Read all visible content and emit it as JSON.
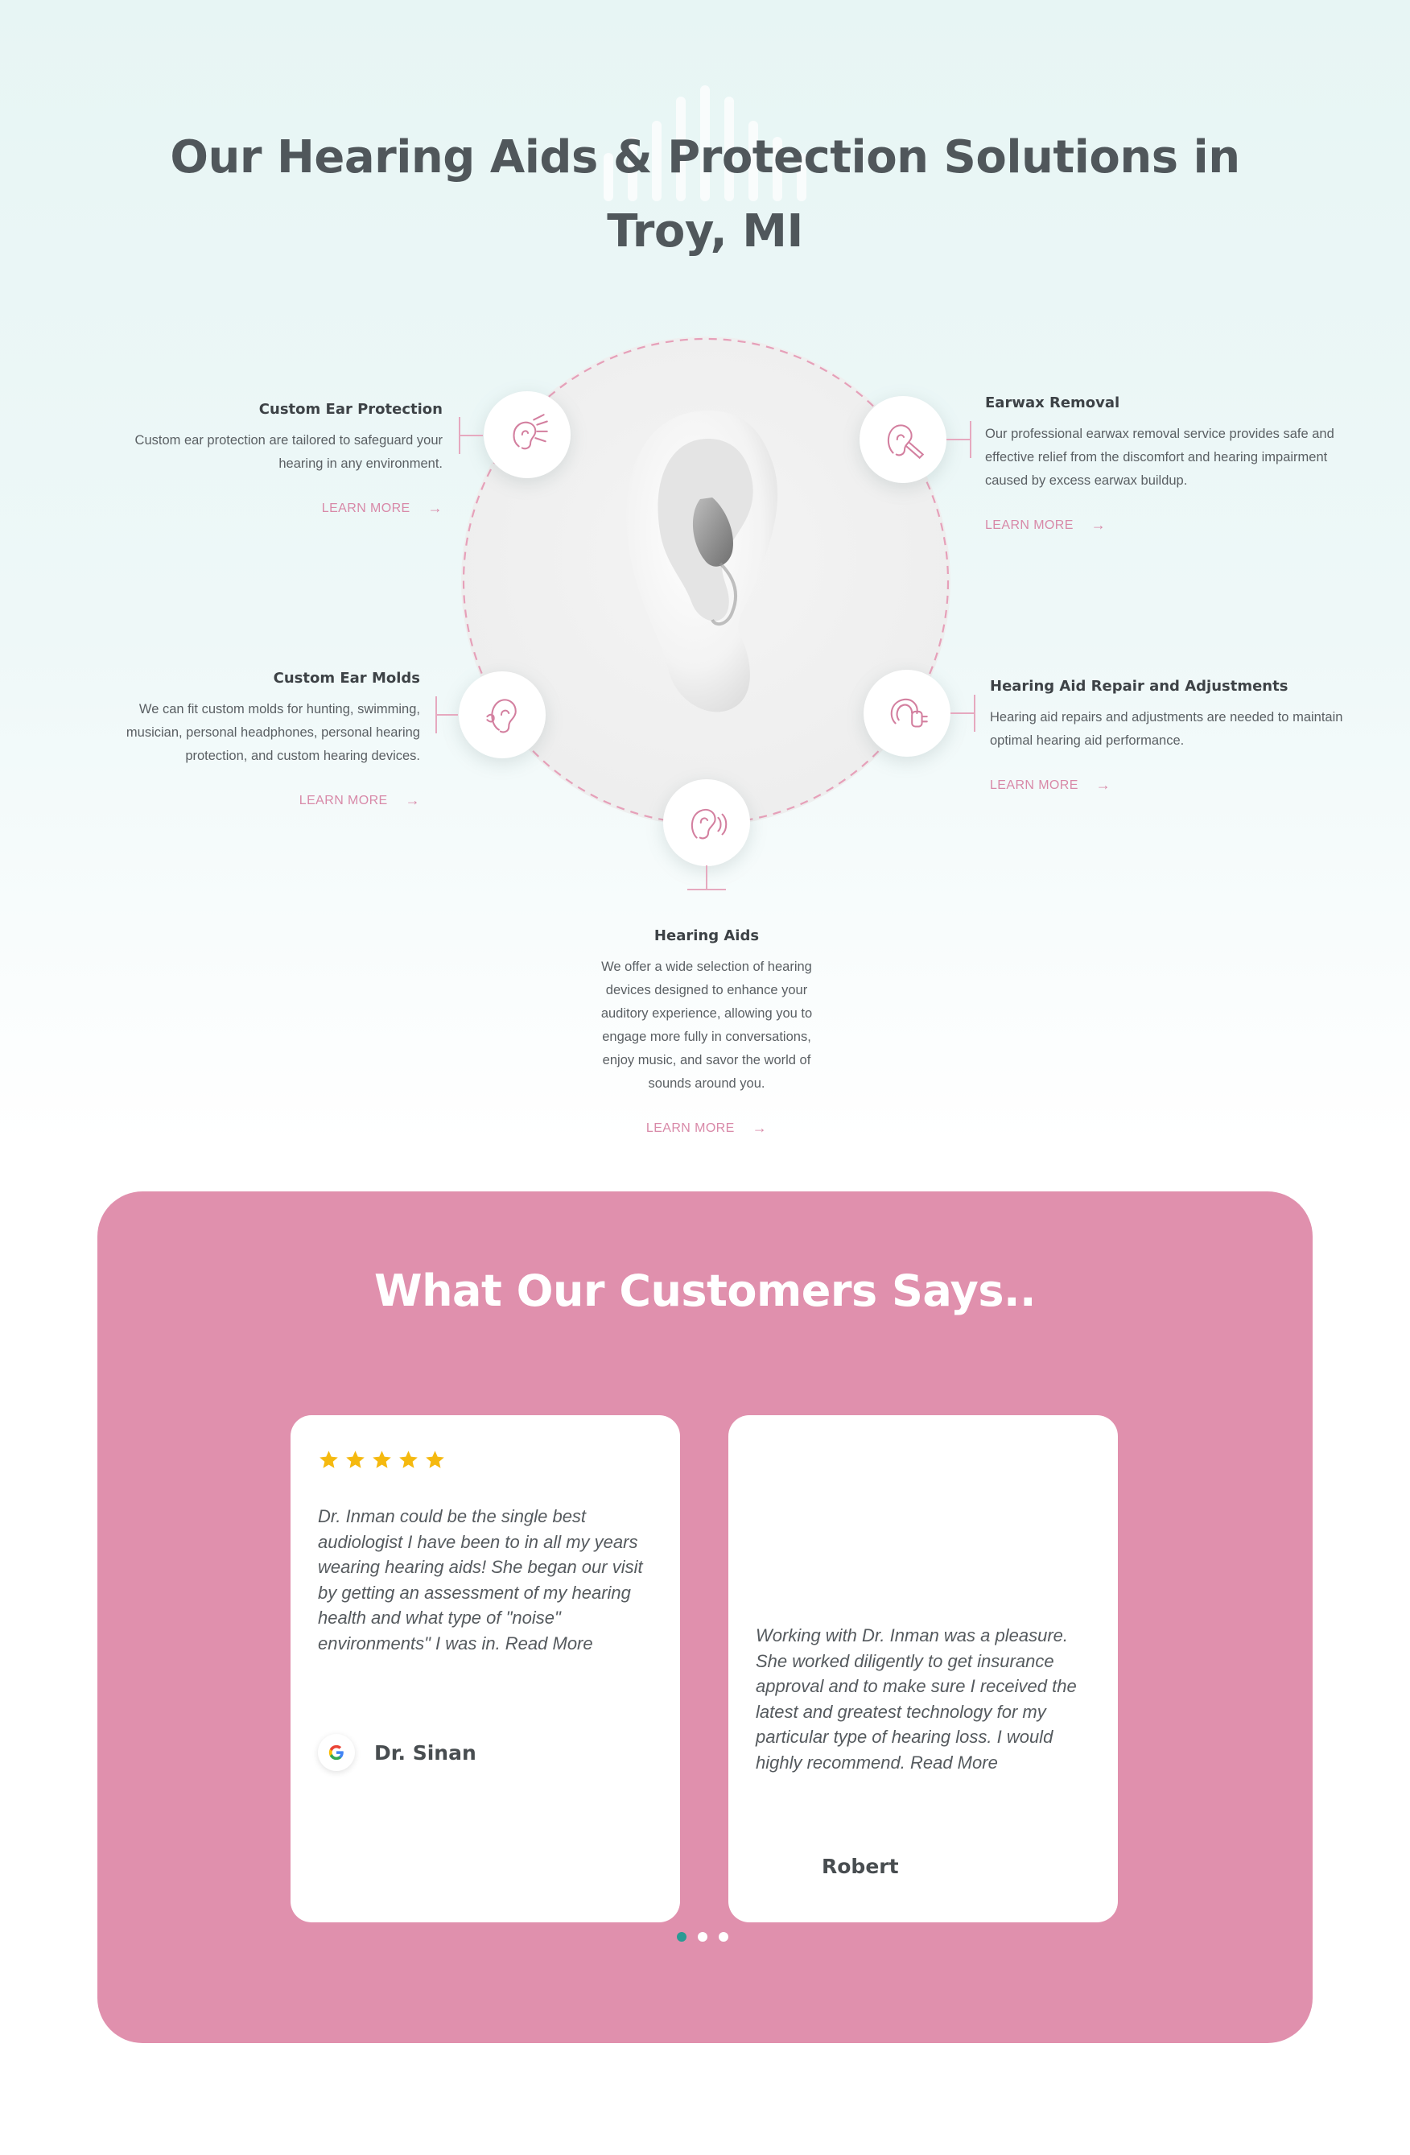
{
  "page": {
    "title": "Our Hearing Aids & Protection Solutions in Troy, MI"
  },
  "services": [
    {
      "name": "Custom Ear Protection",
      "description": "Custom ear protection are tailored to safeguard your hearing in any environment.",
      "link": "LEARN MORE",
      "icon": "ear-protection-icon"
    },
    {
      "name": "Earwax Removal",
      "description": "Our professional earwax removal service provides safe and effective relief from the discomfort and hearing impairment caused by excess earwax buildup.",
      "link": "LEARN MORE",
      "icon": "earwax-removal-icon"
    },
    {
      "name": "Custom Ear Molds",
      "description": "We can fit custom molds for hunting, swimming, musician, personal headphones, personal hearing protection, and custom hearing devices.",
      "link": "LEARN MORE",
      "icon": "ear-mold-icon"
    },
    {
      "name": "Hearing Aid Repair and Adjustments",
      "description": "Hearing aid repairs and adjustments are needed to maintain optimal hearing aid performance.",
      "link": "LEARN MORE",
      "icon": "hearing-aid-repair-icon"
    },
    {
      "name": "Hearing Aids",
      "description": "We offer a wide selection of hearing devices designed to enhance your auditory experience, allowing you to engage more fully in conversations, enjoy music, and savor the world of sounds around you.",
      "link": "LEARN MORE",
      "icon": "hearing-aids-icon"
    }
  ],
  "testimonials": {
    "title": "What Our Customers Says..",
    "reviews": [
      {
        "rating": 5,
        "quote": "Dr. Inman could be the single best audiologist I have been to in all my years wearing hearing aids! She began our visit by getting an assessment of my hearing health and what type of \"noise\" environments\" I was in. Read More",
        "author": "Dr. Sinan",
        "source_icon": "google-icon"
      },
      {
        "quote": "Working with Dr. Inman was a pleasure. She worked diligently to get insurance approval and to make sure I received the latest and greatest technology for my particular type of hearing loss. I would highly recommend. Read More",
        "author": "Robert"
      }
    ],
    "carousel_active_index": 0,
    "carousel_count": 3
  },
  "colors": {
    "accent_pink": "#e090ad",
    "link_pink": "#d889a8",
    "star_yellow": "#f5b90f",
    "dot_active": "#2a9a94",
    "heading_gray": "#50575b"
  }
}
